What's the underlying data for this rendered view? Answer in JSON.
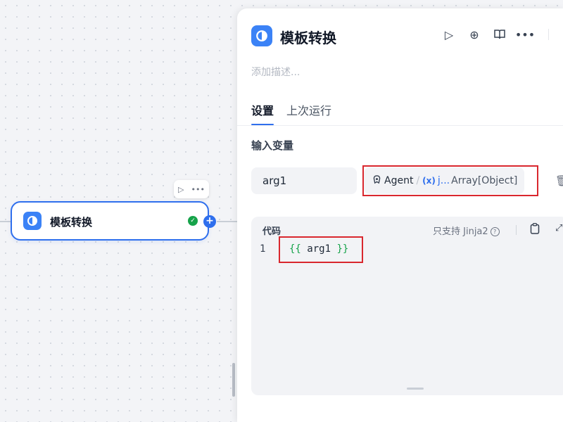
{
  "node": {
    "title": "模板转换",
    "toolbar": {
      "run_icon": "play-icon",
      "more_icon": "more-icon"
    },
    "status_icon": "check-icon",
    "add_icon": "plus-icon"
  },
  "panel": {
    "title": "模板转换",
    "description_placeholder": "添加描述...",
    "actions": [
      "play-icon",
      "locate-icon",
      "book-icon",
      "more-icon"
    ],
    "tabs": [
      {
        "label": "设置",
        "active": true
      },
      {
        "label": "上次运行",
        "active": false
      }
    ],
    "input_section": {
      "label": "输入变量",
      "variable": {
        "name": "arg1",
        "ref_agent": "Agent",
        "ref_separator": "/",
        "ref_icon": "(x)",
        "ref_var": "j...",
        "ref_type": "Array[Object]"
      }
    },
    "code": {
      "label": "代码",
      "hint": "只支持 Jinja2",
      "line_number": "1",
      "open_brace": "{{",
      "expr": "arg1",
      "close_brace": "}}"
    }
  },
  "colors": {
    "accent": "#2f6fed",
    "highlight": "#d9272e",
    "success": "#16a34a"
  }
}
